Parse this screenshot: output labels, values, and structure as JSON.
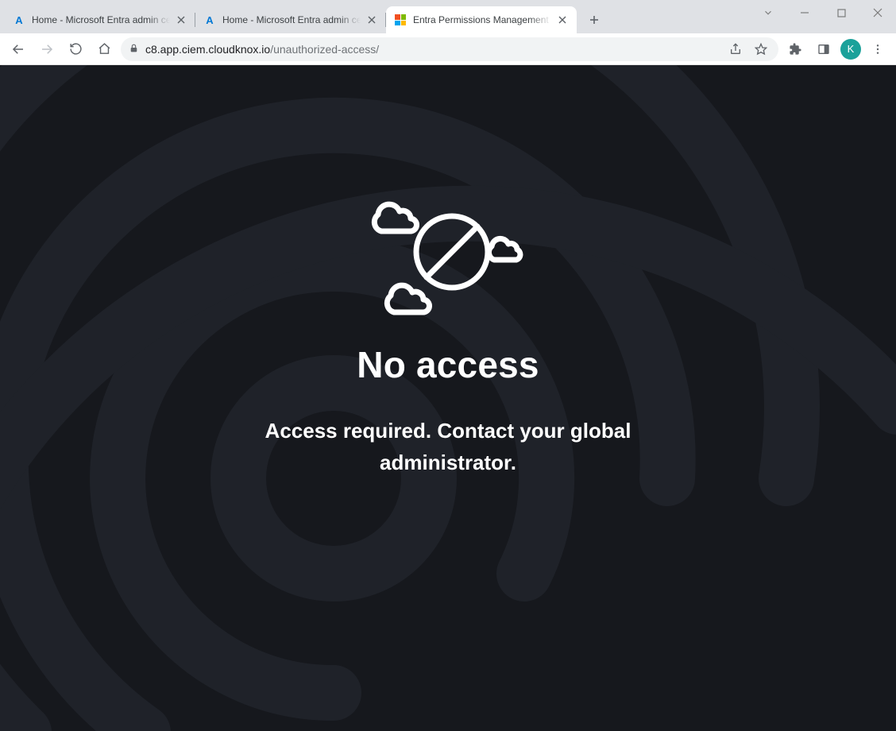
{
  "window": {
    "avatar_initial": "K"
  },
  "tabs": {
    "items": [
      {
        "label": "Home - Microsoft Entra admin center",
        "active": false,
        "icon": "azure"
      },
      {
        "label": "Home - Microsoft Entra admin center",
        "active": false,
        "icon": "azure"
      },
      {
        "label": "Entra Permissions Management",
        "active": true,
        "icon": "microsoft"
      }
    ]
  },
  "address": {
    "host": "c8.app.ciem.cloudknox.io",
    "path": "/unauthorized-access/"
  },
  "page": {
    "headline": "No access",
    "subhead": "Access required. Contact your global administrator."
  }
}
